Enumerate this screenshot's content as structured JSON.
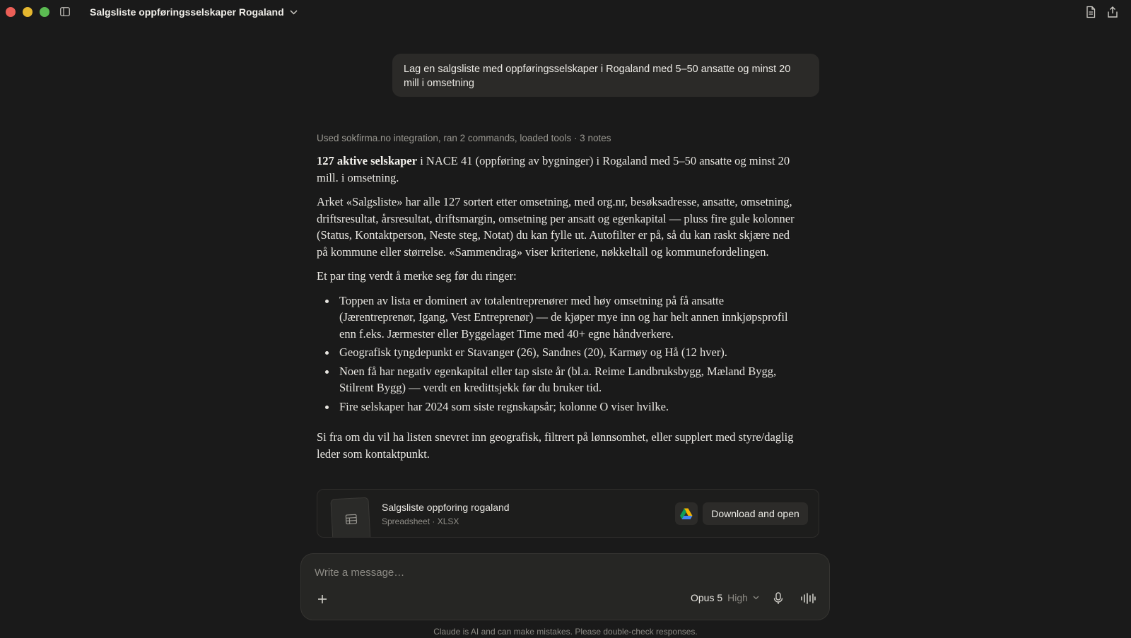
{
  "window": {
    "title": "Salgsliste oppføringsselskaper Rogaland"
  },
  "conversation": {
    "user_message": "Lag en salgsliste med oppføringsselskaper i Rogaland med 5–50 ansatte og minst 20 mill i omsetning",
    "tools_summary": "Used sokfirma.no integration, ran 2 commands, loaded tools · 3 notes",
    "answer": {
      "intro_bold": "127 aktive selskaper",
      "intro_rest": " i NACE 41 (oppføring av bygninger) i Rogaland med 5–50 ansatte og minst 20 mill. i omsetning.",
      "paragraph_2": "Arket «Salgsliste» har alle 127 sortert etter omsetning, med org.nr, besøksadresse, ansatte, omsetning, driftsresultat, årsresultat, driftsmargin, omsetning per ansatt og egenkapital — pluss fire gule kolonner (Status, Kontaktperson, Neste steg, Notat) du kan fylle ut. Autofilter er på, så du kan raskt skjære ned på kommune eller størrelse. «Sammendrag» viser kriteriene, nøkkeltall og kommunefordelingen.",
      "paragraph_3": "Et par ting verdt å merke seg før du ringer:",
      "bullets": [
        "Toppen av lista er dominert av totalentreprenører med høy omsetning på få ansatte (Jærentreprenør, Igang, Vest Entreprenør) — de kjøper mye inn og har helt annen innkjøpsprofil enn f.eks. Jærmester eller Byggelaget Time med 40+ egne håndverkere.",
        "Geografisk tyngdepunkt er Stavanger (26), Sandnes (20), Karmøy og Hå (12 hver).",
        "Noen få har negativ egenkapital eller tap siste år (bl.a. Reime Landbruksbygg, Mæland Bygg, Stilrent Bygg) — verdt en kredittsjekk før du bruker tid.",
        "Fire selskaper har 2024 som siste regnskapsår; kolonne O viser hvilke."
      ],
      "closing": "Si fra om du vil ha listen snevret inn geografisk, filtrert på lønnsomhet, eller supplert med styre/daglig leder som kontaktpunkt."
    },
    "file": {
      "name": "Salgsliste oppforing rogaland",
      "meta": "Spreadsheet · XLSX",
      "download_label": "Download and open"
    }
  },
  "composer": {
    "placeholder": "Write a message…",
    "model": "Opus 5",
    "effort": "High"
  },
  "disclaimer": "Claude is AI and can make mistakes. Please double-check responses."
}
